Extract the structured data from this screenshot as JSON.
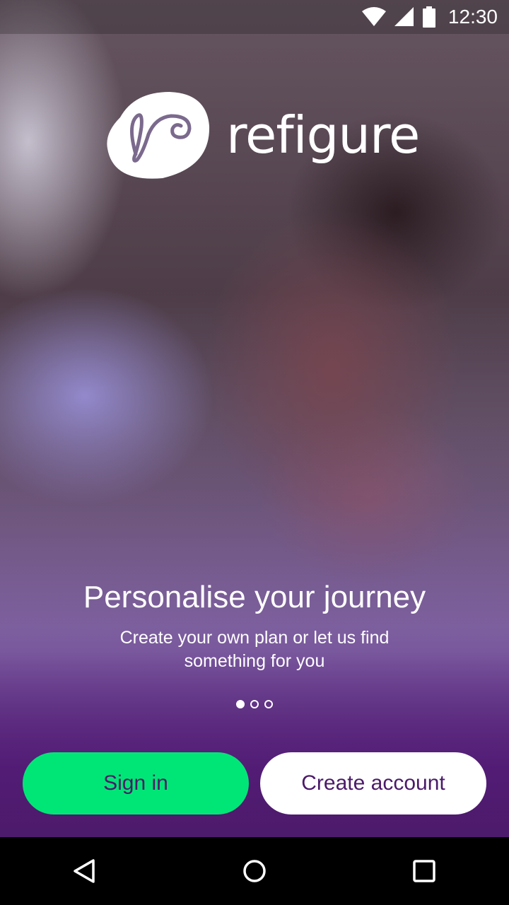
{
  "status_bar": {
    "time": "12:30",
    "icons": [
      "wifi-icon",
      "signal-icon",
      "battery-icon"
    ]
  },
  "brand": {
    "name": "refigure"
  },
  "onboarding": {
    "headline": "Personalise your journey",
    "subtext": "Create your own plan or let us find something for you",
    "page_count": 3,
    "current_page": 1
  },
  "actions": {
    "sign_in_label": "Sign in",
    "create_account_label": "Create account"
  },
  "colors": {
    "accent_green": "#00e676",
    "brand_purple": "#4b1a6a",
    "bottom_purple": "#4d1b6b"
  },
  "navigation_bar": {
    "icons": [
      "back-icon",
      "home-icon",
      "recents-icon"
    ]
  }
}
